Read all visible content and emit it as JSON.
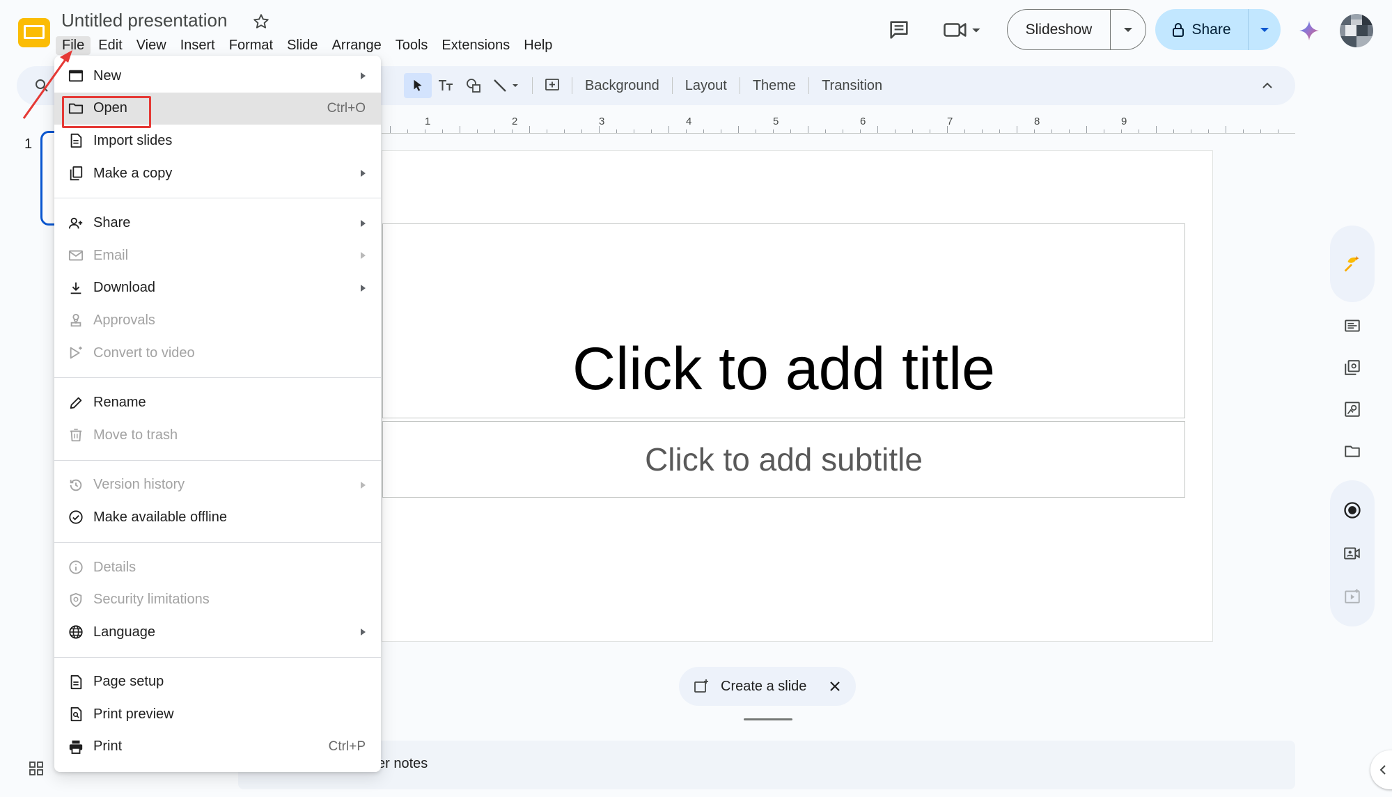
{
  "app": {
    "title": "Untitled presentation",
    "menus": [
      "File",
      "Edit",
      "View",
      "Insert",
      "Format",
      "Slide",
      "Arrange",
      "Tools",
      "Extensions",
      "Help"
    ],
    "active_menu": "File"
  },
  "header": {
    "slideshow_label": "Slideshow",
    "share_label": "Share"
  },
  "toolbar": {
    "background_label": "Background",
    "layout_label": "Layout",
    "theme_label": "Theme",
    "transition_label": "Transition"
  },
  "ruler": {
    "labels": [
      "1",
      "2",
      "3",
      "4",
      "5",
      "6",
      "7",
      "8",
      "9"
    ]
  },
  "filmstrip": {
    "slide_number": "1"
  },
  "slide": {
    "title_placeholder": "Click to add title",
    "subtitle_placeholder": "Click to add subtitle"
  },
  "create_slide": {
    "label": "Create a slide"
  },
  "notes": {
    "label": "Click to add speaker notes",
    "visible_text": "er notes"
  },
  "file_menu": {
    "items": [
      {
        "label": "New",
        "icon": "new-slides-icon",
        "submenu": true,
        "disabled": false
      },
      {
        "label": "Open",
        "icon": "folder-icon",
        "shortcut": "Ctrl+O",
        "disabled": false,
        "highlighted": true
      },
      {
        "label": "Import slides",
        "icon": "document-icon",
        "disabled": false
      },
      {
        "label": "Make a copy",
        "icon": "copy-icon",
        "submenu": true,
        "disabled": false
      },
      {
        "label": "Share",
        "icon": "person-add-icon",
        "submenu": true,
        "disabled": false
      },
      {
        "label": "Email",
        "icon": "email-icon",
        "submenu": true,
        "disabled": true
      },
      {
        "label": "Download",
        "icon": "download-icon",
        "submenu": true,
        "disabled": false
      },
      {
        "label": "Approvals",
        "icon": "approvals-icon",
        "disabled": true
      },
      {
        "label": "Convert to video",
        "icon": "video-icon",
        "disabled": true
      },
      {
        "label": "Rename",
        "icon": "pencil-icon",
        "disabled": false
      },
      {
        "label": "Move to trash",
        "icon": "trash-icon",
        "disabled": true
      },
      {
        "label": "Version history",
        "icon": "history-icon",
        "submenu": true,
        "disabled": true
      },
      {
        "label": "Make available offline",
        "icon": "offline-icon",
        "disabled": false
      },
      {
        "label": "Details",
        "icon": "info-icon",
        "disabled": true
      },
      {
        "label": "Security limitations",
        "icon": "shield-icon",
        "disabled": true
      },
      {
        "label": "Language",
        "icon": "globe-icon",
        "submenu": true,
        "disabled": false
      },
      {
        "label": "Page setup",
        "icon": "page-icon",
        "disabled": false
      },
      {
        "label": "Print preview",
        "icon": "print-preview-icon",
        "disabled": false
      },
      {
        "label": "Print",
        "icon": "print-icon",
        "shortcut": "Ctrl+P",
        "disabled": false
      }
    ]
  },
  "colors": {
    "accent_blue": "#0b57d0",
    "share_bg": "#c2e7ff",
    "annotation_red": "#e53935",
    "logo_yellow": "#fbbc04"
  }
}
